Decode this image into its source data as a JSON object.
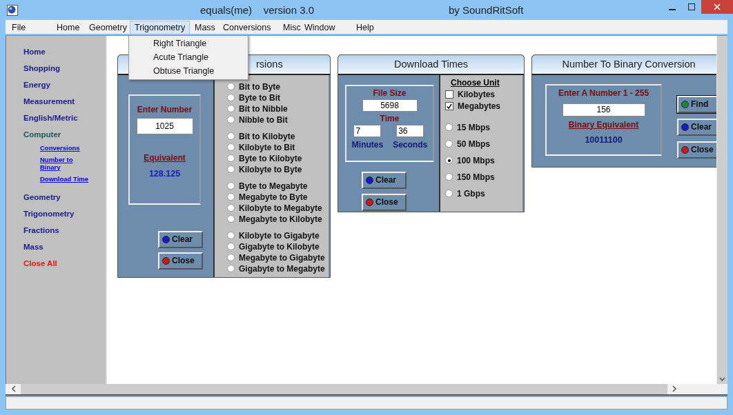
{
  "window": {
    "title": "equals(me)    version 3.0",
    "vendor": "by SoundRitSoft"
  },
  "menu": [
    {
      "label": "File",
      "selected": false
    },
    {
      "label": "Home",
      "selected": false
    },
    {
      "label": "Geometry",
      "selected": false
    },
    {
      "label": "Trigonometry",
      "selected": true
    },
    {
      "label": "Mass",
      "selected": false
    },
    {
      "label": "Conversions",
      "selected": false
    },
    {
      "label": "Misc",
      "selected": false
    },
    {
      "label": "Window",
      "selected": false
    },
    {
      "label": "Help",
      "selected": false
    }
  ],
  "dropdown": [
    "Right Triangle",
    "Acute Triangle",
    "Obtuse Triangle"
  ],
  "sidebar": {
    "items": [
      {
        "label": "Home",
        "kind": "nav",
        "selected": false
      },
      {
        "label": "Shopping",
        "kind": "nav",
        "selected": false
      },
      {
        "label": "Energy",
        "kind": "nav",
        "selected": false
      },
      {
        "label": "Measurement",
        "kind": "nav",
        "selected": false
      },
      {
        "label": "English/Metric",
        "kind": "nav",
        "selected": false
      },
      {
        "label": "Computer",
        "kind": "nav",
        "selected": true,
        "children": [
          "Conversions",
          "Number to Binary",
          "Download Time"
        ]
      },
      {
        "label": "Geometry",
        "kind": "nav",
        "selected": false
      },
      {
        "label": "Trigonometry",
        "kind": "nav",
        "selected": false
      },
      {
        "label": "Fractions",
        "kind": "nav",
        "selected": false
      },
      {
        "label": "Mass",
        "kind": "nav",
        "selected": false
      },
      {
        "label": "Close All",
        "kind": "close",
        "selected": false
      }
    ]
  },
  "conversions": {
    "title": "rsions",
    "input_label": "Enter Number",
    "input": "1025",
    "result_label": "Equivalent",
    "result": "128.125",
    "buttons": [
      {
        "label": "Clear",
        "color": "#1a1acc"
      },
      {
        "label": "Close",
        "color": "#cc1a1a"
      }
    ],
    "option_groups": [
      [
        {
          "label": "Bit to Byte",
          "selected": false
        },
        {
          "label": "Byte to Bit",
          "selected": false
        },
        {
          "label": "Bit to Nibble",
          "selected": false
        },
        {
          "label": "Nibble to Bit",
          "selected": false
        }
      ],
      [
        {
          "label": "Bit to Kilobyte",
          "selected": false
        },
        {
          "label": "Kilobyte to Bit",
          "selected": false
        },
        {
          "label": "Byte to Kilobyte",
          "selected": false
        },
        {
          "label": "Kilobyte to Byte",
          "selected": false
        }
      ],
      [
        {
          "label": "Byte to Megabyte",
          "selected": false
        },
        {
          "label": "Megabyte to Byte",
          "selected": false
        },
        {
          "label": "Kilobyte to Megabyte",
          "selected": false
        },
        {
          "label": "Megabyte to Kilobyte",
          "selected": false
        }
      ],
      [
        {
          "label": "Kilobyte to Gigabyte",
          "selected": false
        },
        {
          "label": "Gigabyte to Kilobyte",
          "selected": false
        },
        {
          "label": "Megabyte to Gigabyte",
          "selected": false
        },
        {
          "label": "Gigabyte to Megabyte",
          "selected": false
        }
      ]
    ]
  },
  "download": {
    "title": "Download Times",
    "size_label": "File Size",
    "size": "5698",
    "time_label": "Time",
    "minutes": "7",
    "seconds": "36",
    "minutes_label": "Minutes",
    "seconds_label": "Seconds",
    "buttons": [
      {
        "label": "Clear",
        "color": "#1a1acc"
      },
      {
        "label": "Close",
        "color": "#cc1a1a"
      }
    ],
    "unit_label": "Choose Unit",
    "units": [
      {
        "label": "Kilobytes",
        "checked": false
      },
      {
        "label": "Megabytes",
        "checked": true
      }
    ],
    "speeds": [
      {
        "label": "15 Mbps",
        "selected": false
      },
      {
        "label": "50 Mbps",
        "selected": false
      },
      {
        "label": "100 Mbps",
        "selected": true
      },
      {
        "label": "150 Mbps",
        "selected": false
      },
      {
        "label": "1 Gbps",
        "selected": false
      }
    ]
  },
  "binary": {
    "title": "Number To Binary Conversion",
    "input_label": "Enter A Number 1 - 255",
    "input": "156",
    "result_label": "Binary Equivalent",
    "result": "10011100",
    "buttons": [
      {
        "label": "Find",
        "color": "#1a8a3a",
        "default": true
      },
      {
        "label": "Clear",
        "color": "#1a1acc",
        "default": false
      },
      {
        "label": "Close",
        "color": "#cc1a1a",
        "default": false
      }
    ]
  }
}
